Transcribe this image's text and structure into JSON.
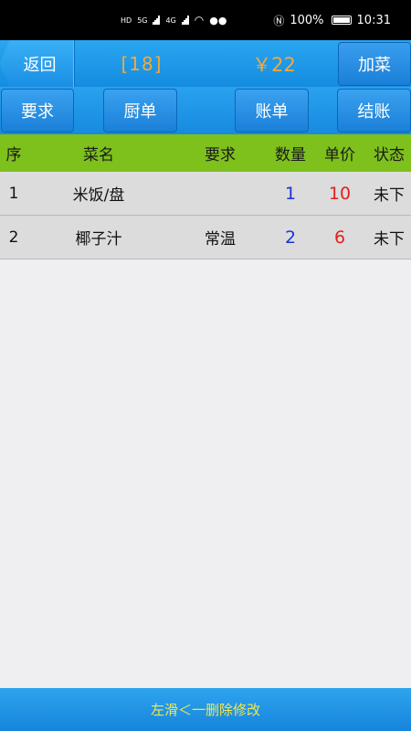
{
  "status_bar": {
    "left_indicators": [
      "HD",
      "5G",
      "4G"
    ],
    "battery": "100%",
    "time": "10:31"
  },
  "header": {
    "back_label": "返回",
    "table_number": "[18]",
    "total": "￥22",
    "add_label": "加菜"
  },
  "actions": {
    "requirement": "要求",
    "kitchen_order": "厨单",
    "bill": "账单",
    "checkout": "结账"
  },
  "table": {
    "headers": {
      "seq": "序",
      "name": "菜名",
      "requirement": "要求",
      "quantity": "数量",
      "unit_price": "单价",
      "status": "状态"
    },
    "rows": [
      {
        "seq": "1",
        "name": "米饭/盘",
        "requirement": "",
        "quantity": "1",
        "unit_price": "10",
        "status": "未下"
      },
      {
        "seq": "2",
        "name": "椰子汁",
        "requirement": "常温",
        "quantity": "2",
        "unit_price": "6",
        "status": "未下"
      }
    ]
  },
  "footer": {
    "hint": "左滑＜一删除修改"
  }
}
